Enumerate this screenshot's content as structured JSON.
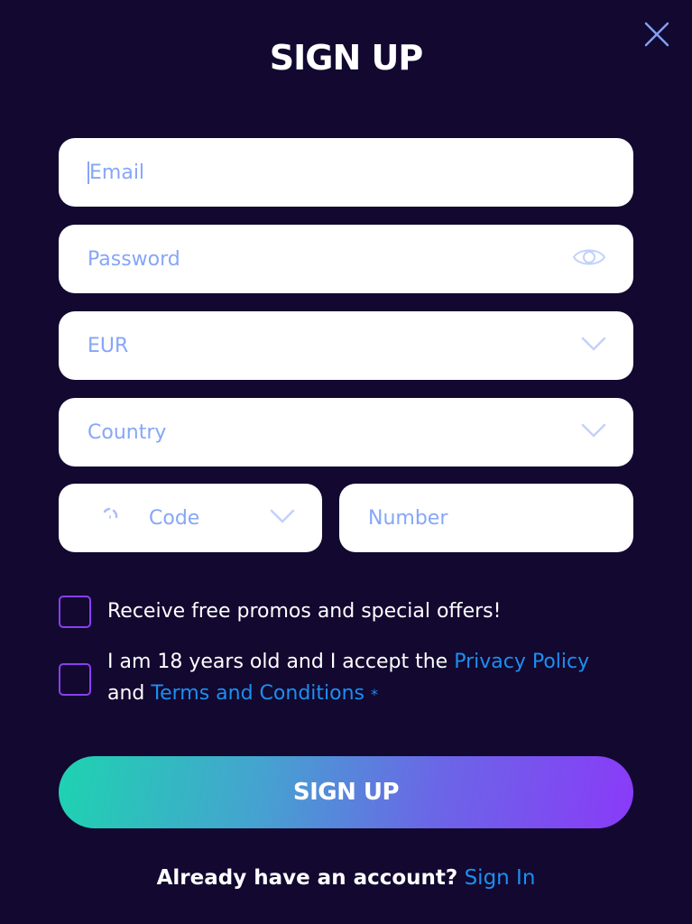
{
  "modal": {
    "title": "SIGN UP",
    "close_icon": "close-icon"
  },
  "form": {
    "email": {
      "placeholder": "Email",
      "value": ""
    },
    "password": {
      "placeholder": "Password",
      "value": "",
      "toggle_icon": "eye-icon"
    },
    "currency": {
      "selected": "EUR",
      "icon": "chevron-down-icon"
    },
    "country": {
      "placeholder": "Country",
      "icon": "chevron-down-icon"
    },
    "phone_code": {
      "placeholder": "Code",
      "loading_icon": "spinner-icon",
      "icon": "chevron-down-icon"
    },
    "phone_number": {
      "placeholder": "Number",
      "value": ""
    },
    "promos": {
      "label": "Receive free promos and special offers!",
      "checked": false
    },
    "terms": {
      "text_before": "I am 18 years old and I accept the ",
      "privacy_link": "Privacy Policy",
      "text_middle": " and ",
      "terms_link": "Terms and Conditions",
      "required_marker": "*",
      "checked": false
    },
    "submit_label": "SIGN UP"
  },
  "footer": {
    "question": "Already have an account?",
    "sign_in_link": "Sign In"
  },
  "colors": {
    "background": "#120830",
    "placeholder": "#86a6f7",
    "link": "#1c8ff0",
    "checkbox_border": "#8a3ff0",
    "gradient_start": "#1ed3b0",
    "gradient_end": "#8a3af8"
  }
}
